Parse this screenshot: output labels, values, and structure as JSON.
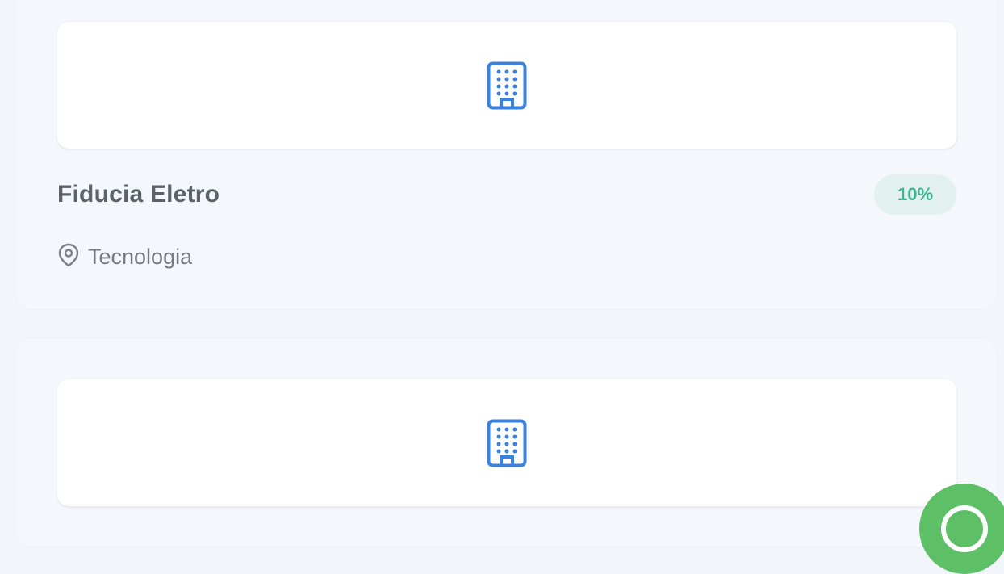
{
  "companies": [
    {
      "name": "Fiducia Eletro",
      "discount": "10%",
      "category": "Tecnologia",
      "logo_icon": "building-icon"
    },
    {
      "logo_icon": "building-icon"
    }
  ],
  "colors": {
    "accent_blue": "#3b82e0",
    "badge_text": "#3db68e",
    "badge_background": "#e3f1ee",
    "fab_green": "#5dbf66"
  },
  "fab": {
    "icon": "whatsapp-icon"
  }
}
